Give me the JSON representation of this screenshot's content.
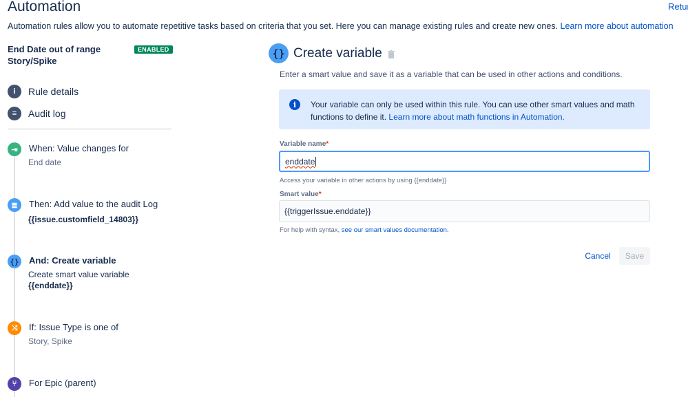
{
  "header": {
    "title": "Automation",
    "return_link": "Return",
    "intro": "Automation rules allow you to automate repetitive tasks based on criteria that you set. Here you can manage existing rules and create new ones.",
    "intro_link": "Learn more about automation"
  },
  "rule": {
    "name": "End Date out of range Story/Spike",
    "status": "ENABLED",
    "status_color": "#00875a"
  },
  "nav": {
    "items": [
      {
        "label": "Rule details",
        "icon": "info-icon"
      },
      {
        "label": "Audit log",
        "icon": "list-icon"
      }
    ]
  },
  "steps": [
    {
      "icon": "trigger-icon",
      "color": "#36b37e",
      "title": "When: Value changes for",
      "subtitle": "End date"
    },
    {
      "icon": "log-action-icon",
      "color": "#4a9ff5",
      "title": "Then: Add value to the audit Log",
      "subtitle": "{{issue.customfield_14803}}"
    },
    {
      "icon": "variable-icon",
      "color": "#4a9ff5",
      "title": "And: Create variable",
      "subtitle": "Create smart value variable",
      "subtitle2": "{{enddate}}"
    },
    {
      "icon": "condition-icon",
      "color": "#ff8b00",
      "title": "If: Issue Type is one of",
      "subtitle": "Story, Spike"
    },
    {
      "icon": "branch-icon",
      "color": "#5243aa",
      "title": "For Epic (parent)"
    }
  ],
  "panel": {
    "icon": "variable-icon",
    "title": "Create variable",
    "description": "Enter a smart value and save it as a variable that can be used in other actions and conditions.",
    "info_text": "Your variable can only be used within this rule. You can use other smart values and math functions to define it.",
    "info_link": "Learn more about math functions in Automation.",
    "variable_name": {
      "label": "Variable name",
      "value": "enddate",
      "help": "Access your variable in other actions by using {{enddate}}"
    },
    "smart_value": {
      "label": "Smart value",
      "value": "{{triggerIssue.enddate}}",
      "help": "For help with syntax,",
      "help_link": "see our smart values documentation."
    },
    "cancel_label": "Cancel",
    "save_label": "Save"
  }
}
